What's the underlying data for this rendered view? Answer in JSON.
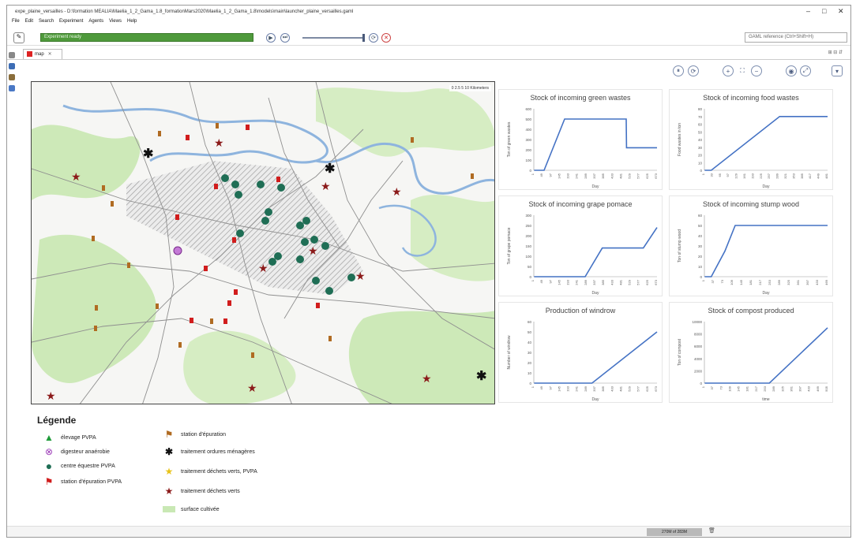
{
  "window": {
    "title": "expe_plaine_versailles - D:\\formation MEALIA\\Maelia_1_2_Gama_1.8_formationMars2020\\Maelia_1_2_Gama_1.8\\models\\main\\launcher_plaine_versailles.gaml",
    "controls": [
      "–",
      "□",
      "✕"
    ]
  },
  "menu": [
    "File",
    "Edit",
    "Search",
    "Experiment",
    "Agents",
    "Views",
    "Help"
  ],
  "toolbar": {
    "status": "Experiment ready",
    "search_placeholder": "GAML reference (Ctrl+Shift+H)"
  },
  "tab": {
    "label": "map"
  },
  "map": {
    "scale_text": "0     2.5      5              10 Kilometers"
  },
  "charts": [
    {
      "title": "Stock of incoming green wastes",
      "xlabel": "Day",
      "ylabel": "Ton of green wastes",
      "ylim": [
        0,
        600
      ],
      "yticks": [
        "0",
        "100",
        "200",
        "300",
        "400",
        "500",
        "600"
      ],
      "xticks": [
        "1",
        "49",
        "97",
        "145",
        "193",
        "241",
        "289",
        "337",
        "385",
        "433",
        "481",
        "529",
        "577",
        "625",
        "673"
      ],
      "x": [
        1,
        30,
        90,
        150,
        270,
        271,
        360
      ],
      "y": [
        0,
        0,
        500,
        500,
        500,
        220,
        220
      ]
    },
    {
      "title": "Stock of incoming food wastes",
      "xlabel": "Day",
      "ylabel": "Food wastes in ton",
      "ylim": [
        0,
        80
      ],
      "yticks": [
        "0",
        "10",
        "20",
        "30",
        "40",
        "50",
        "60",
        "70",
        "80"
      ],
      "xticks": [
        "1",
        "33",
        "65",
        "97",
        "129",
        "161",
        "193",
        "225",
        "257",
        "289",
        "321",
        "353",
        "385",
        "417",
        "449",
        "481"
      ],
      "x": [
        1,
        20,
        220,
        360
      ],
      "y": [
        0,
        0,
        70,
        70
      ]
    },
    {
      "title": "Stock of incoming grape pomace",
      "xlabel": "Day",
      "ylabel": "Ton of grape pomace",
      "ylim": [
        0,
        300
      ],
      "yticks": [
        "0",
        "50",
        "100",
        "150",
        "200",
        "250",
        "300"
      ],
      "xticks": [
        "1",
        "49",
        "97",
        "145",
        "193",
        "241",
        "289",
        "337",
        "385",
        "433",
        "481",
        "529",
        "577",
        "625",
        "673"
      ],
      "x": [
        1,
        150,
        200,
        320,
        360
      ],
      "y": [
        0,
        0,
        140,
        140,
        240
      ]
    },
    {
      "title": "Stock of incoming stump wood",
      "xlabel": "Day",
      "ylabel": "Ton of stump wood",
      "ylim": [
        0,
        60
      ],
      "yticks": [
        "0",
        "10",
        "20",
        "30",
        "40",
        "50",
        "60"
      ],
      "xticks": [
        "1",
        "37",
        "73",
        "109",
        "145",
        "181",
        "217",
        "253",
        "289",
        "325",
        "361",
        "397",
        "433",
        "469"
      ],
      "x": [
        1,
        20,
        60,
        90,
        360
      ],
      "y": [
        0,
        0,
        25,
        50,
        50
      ]
    },
    {
      "title": "Production of windrow",
      "xlabel": "Day",
      "ylabel": "Number of windrow",
      "ylim": [
        0,
        60
      ],
      "yticks": [
        "0",
        "10",
        "20",
        "30",
        "40",
        "50",
        "60"
      ],
      "xticks": [
        "1",
        "49",
        "97",
        "145",
        "193",
        "241",
        "289",
        "337",
        "385",
        "433",
        "481",
        "529",
        "577",
        "625",
        "673"
      ],
      "x": [
        1,
        170,
        360
      ],
      "y": [
        0,
        0,
        50
      ]
    },
    {
      "title": "Stock of compost produced",
      "xlabel": "time",
      "ylabel": "Ton of compost",
      "ylim": [
        0,
        10000
      ],
      "yticks": [
        "0",
        "2000",
        "4000",
        "6000",
        "8000",
        "10000"
      ],
      "xticks": [
        "1",
        "37",
        "73",
        "109",
        "145",
        "181",
        "217",
        "253",
        "289",
        "325",
        "361",
        "397",
        "433",
        "469",
        "505"
      ],
      "x": [
        1,
        190,
        360
      ],
      "y": [
        0,
        0,
        9000
      ]
    }
  ],
  "legend": {
    "title": "Légende",
    "items_left": [
      {
        "label": "élevage PVPA",
        "icon": "triangle"
      },
      {
        "label": "digesteur anaérobie",
        "icon": "circle-x"
      },
      {
        "label": "centre équestre PVPA",
        "icon": "circle"
      },
      {
        "label": "station d'épuration PVPA",
        "icon": "flag"
      }
    ],
    "items_right": [
      {
        "label": "station d'épuration",
        "icon": "flag-brown"
      },
      {
        "label": "traitement ordures ménagères",
        "icon": "asterisk"
      },
      {
        "label": "traitement déchets verts, PVPA",
        "icon": "star-yellow"
      },
      {
        "label": "traitement déchets verts",
        "icon": "star-red"
      },
      {
        "label": "surface cultivée",
        "icon": "rect-green"
      }
    ]
  },
  "status": {
    "memory": "270M of 283M"
  },
  "colors": {
    "line": "#4472c4",
    "green_area": "#c9e8b4",
    "river": "#8eb4de",
    "progress": "#4f9a3c"
  }
}
